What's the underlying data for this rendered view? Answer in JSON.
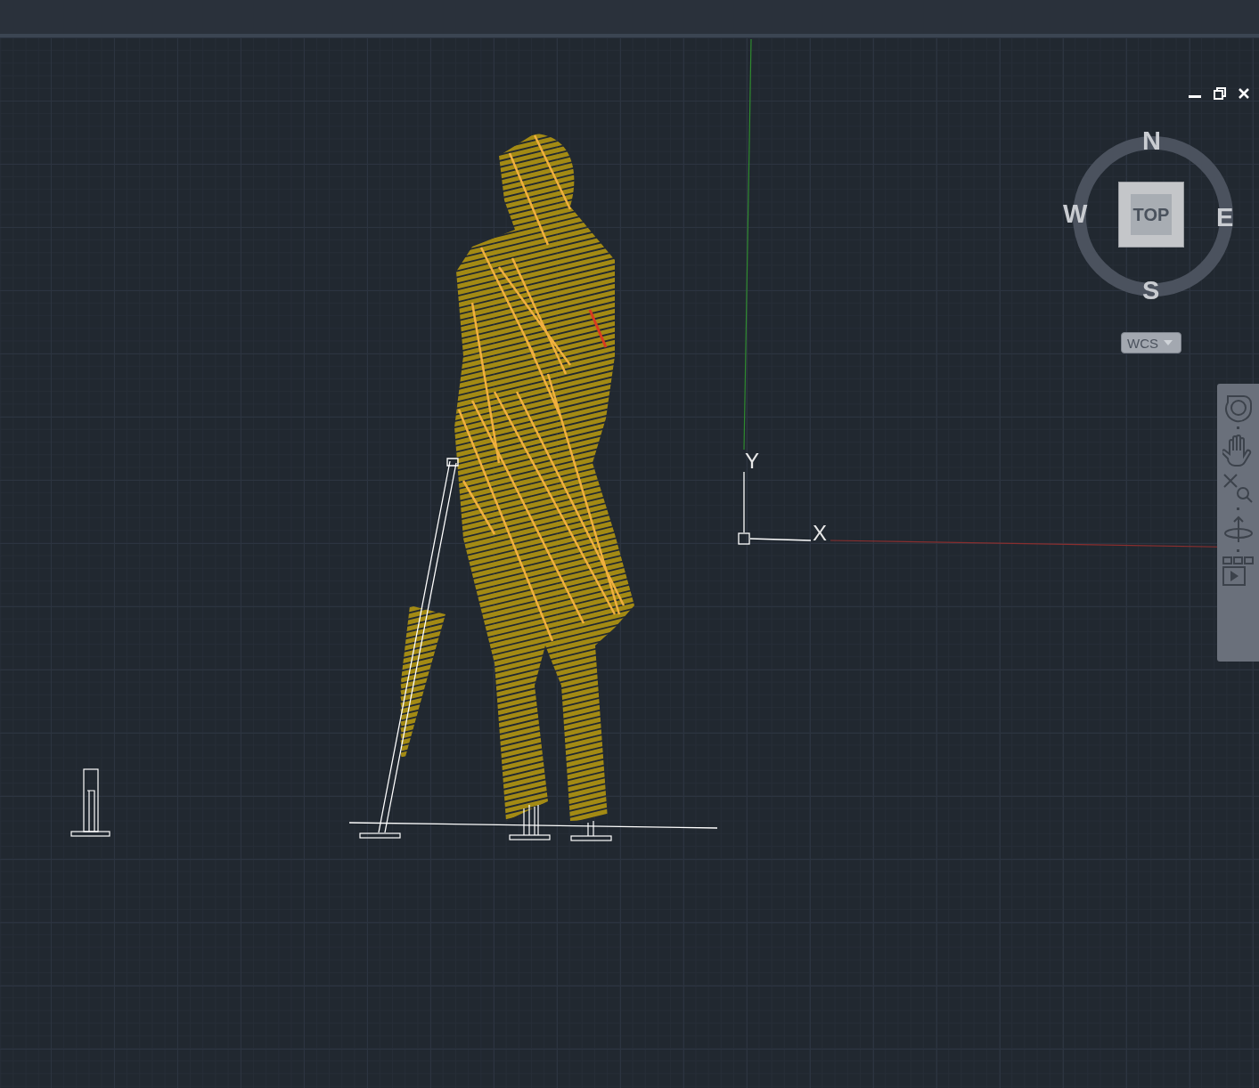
{
  "viewcube": {
    "face": "TOP",
    "compass": {
      "north": "N",
      "east": "E",
      "south": "S",
      "west": "W"
    }
  },
  "coordinate_system": "WCS",
  "ucs_icon": {
    "y_label": "Y",
    "x_label": "X"
  }
}
